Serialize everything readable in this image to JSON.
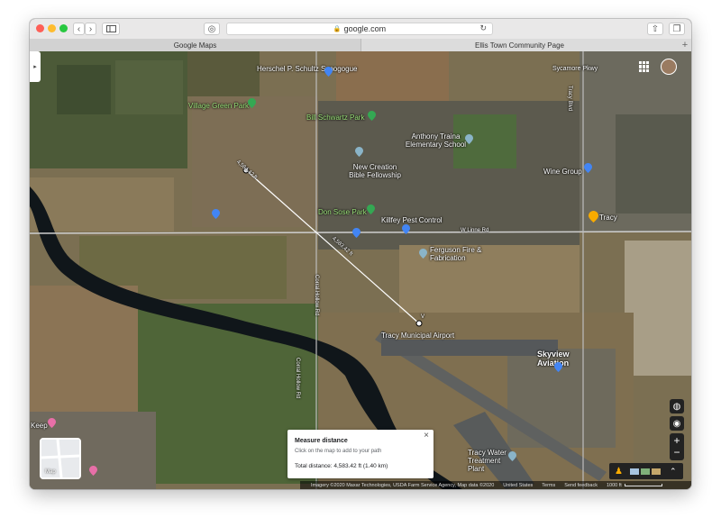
{
  "browser": {
    "url": "google.com",
    "tabs": [
      {
        "label": "Google Maps",
        "active": true
      },
      {
        "label": "Ellis Town Community Page",
        "active": false
      }
    ]
  },
  "map": {
    "labels": {
      "synagogue": "Herschel P. Schultz Synogogue",
      "sycamore": "Sycamore Pkwy",
      "village_green": "Village Green Park",
      "bill_schwartz": "Bill Schwartz Park",
      "anthony_traina": "Anthony Traina Elementary School",
      "new_creation": "New Creation Bible Fellowship",
      "wine_group": "Wine Group",
      "don_sose": "Don Sose Park",
      "killfey": "Killfey Pest Control",
      "w_linne": "W Linne Rd",
      "tracy": "Tracy",
      "ferguson": "Ferguson Fire & Fabrication",
      "tracy_airport": "Tracy Municipal Airport",
      "skyview": "Skyview Aviation",
      "tracy_water": "Tracy Water Treatment Plant",
      "keep": "Keep",
      "tracy_blvd": "Tracy Blvd",
      "corral_hollow": "Corral Hollow Rd",
      "corral_hollow_2": "Corral Hollow Rd",
      "seg1": "4,584.42 ft",
      "seg2": "4,583.42 ft",
      "v_label": "V"
    },
    "thumb_label": "Map",
    "measure": {
      "title": "Measure distance",
      "hint": "Click on the map to add to your path",
      "total": "Total distance: 4,583.42 ft (1.40 km)"
    },
    "footer": {
      "imagery": "Imagery ©2020 Maxar Technologies, USDA Farm Service Agency, Map data ©2020",
      "country": "United States",
      "terms": "Terms",
      "feedback": "Send feedback",
      "scale": "1000 ft"
    },
    "colors": {
      "green_pin": "#34a853",
      "blue_pin": "#4285f4",
      "orange_pin": "#f9ab00",
      "pink_pin": "#e86fa8"
    }
  }
}
